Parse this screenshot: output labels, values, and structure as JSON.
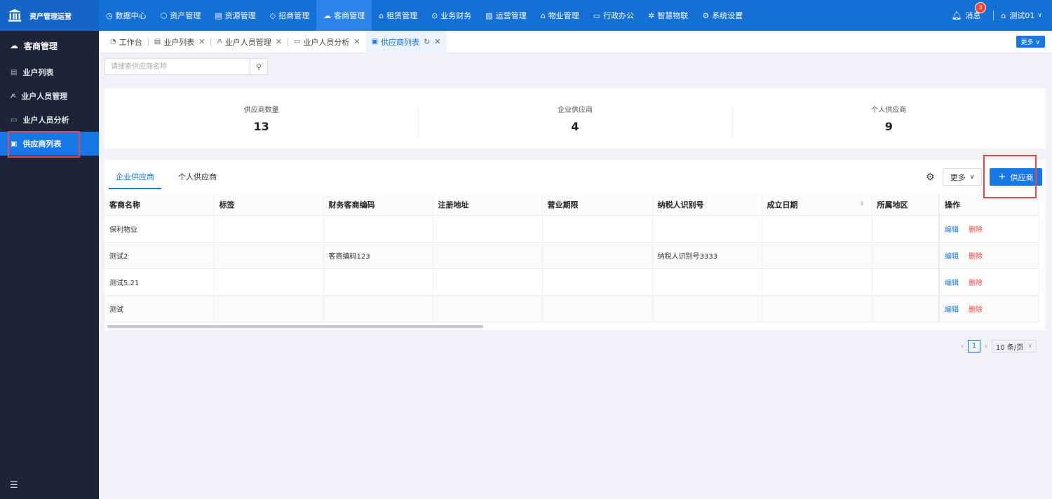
{
  "app": {
    "title": "资产管理运营"
  },
  "topnav": [
    {
      "icon": "clock-icon",
      "glyph": "◷",
      "label": "数据中心"
    },
    {
      "icon": "cube-icon",
      "glyph": "⬡",
      "label": "资产管理"
    },
    {
      "icon": "building-icon",
      "glyph": "▤",
      "label": "资源管理"
    },
    {
      "icon": "tag-icon",
      "glyph": "◇",
      "label": "招商管理"
    },
    {
      "icon": "cloud-user-icon",
      "glyph": "☁",
      "label": "客商管理"
    },
    {
      "icon": "house-icon",
      "glyph": "⌂",
      "label": "租赁管理"
    },
    {
      "icon": "coin-icon",
      "glyph": "⊙",
      "label": "业务财务"
    },
    {
      "icon": "chart-icon",
      "glyph": "▧",
      "label": "运营管理"
    },
    {
      "icon": "home-icon",
      "glyph": "⌂",
      "label": "物业管理"
    },
    {
      "icon": "monitor-icon",
      "glyph": "▭",
      "label": "行政办公"
    },
    {
      "icon": "atom-icon",
      "glyph": "✲",
      "label": "智慧物联"
    },
    {
      "icon": "gear-icon",
      "glyph": "⚙",
      "label": "系统设置"
    }
  ],
  "header": {
    "messages_label": "消息",
    "messages_count": "3",
    "user_name": "测试01"
  },
  "sidebar": {
    "title": "客商管理",
    "items": [
      {
        "label": "业户列表",
        "glyph": "▤"
      },
      {
        "label": "业户人员管理",
        "glyph": "ዶ"
      },
      {
        "label": "业户人员分析",
        "glyph": "▭"
      },
      {
        "label": "供应商列表",
        "glyph": "▣"
      }
    ]
  },
  "tabs": [
    {
      "label": "工作台",
      "glyph": "◔"
    },
    {
      "label": "业户列表",
      "glyph": "▤"
    },
    {
      "label": "业户人员管理",
      "glyph": "ዶ"
    },
    {
      "label": "业户人员分析",
      "glyph": "▭"
    },
    {
      "label": "供应商列表",
      "glyph": "▣"
    }
  ],
  "tabs_more": "更多",
  "search": {
    "placeholder": "请搜索供应商名称"
  },
  "stats": [
    {
      "label": "供应商数量",
      "value": "13"
    },
    {
      "label": "企业供应商",
      "value": "4"
    },
    {
      "label": "个人供应商",
      "value": "9"
    }
  ],
  "panel": {
    "tabs": [
      "企业供应商",
      "个人供应商"
    ],
    "more": "更多",
    "add": "供应商"
  },
  "table": {
    "columns": [
      "客商名称",
      "标签",
      "财务客商编码",
      "注册地址",
      "营业期限",
      "纳税人识别号",
      "成立日期",
      "所属地区",
      "操作"
    ],
    "rows": [
      [
        "保利物业",
        "",
        "",
        "",
        "",
        "",
        "",
        ""
      ],
      [
        "测试2",
        "",
        "客商编码123",
        "",
        "",
        "纳税人识别号3333",
        "",
        ""
      ],
      [
        "测试5.21",
        "",
        "",
        "",
        "",
        "",
        "",
        ""
      ],
      [
        "测试",
        "",
        "",
        "",
        "",
        "",
        "",
        ""
      ]
    ],
    "edit": "编辑",
    "delete": "删除"
  },
  "pagination": {
    "current": "1",
    "page_size": "10 条/页"
  },
  "colors": {
    "primary": "#1677e6",
    "topbar": "#1570d6",
    "sidebar": "#1d2438",
    "danger": "#f5453d",
    "highlight": "#e8474a"
  }
}
